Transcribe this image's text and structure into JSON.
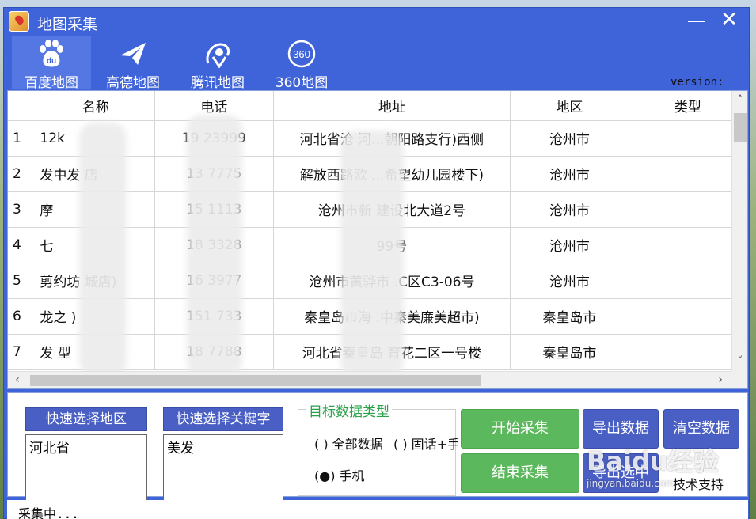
{
  "window": {
    "title": "地图采集"
  },
  "tabs": [
    {
      "label": "百度地图",
      "icon": "baidu-paw-icon"
    },
    {
      "label": "高德地图",
      "icon": "paper-plane-icon"
    },
    {
      "label": "腾讯地图",
      "icon": "tencent-pin-icon"
    },
    {
      "label": "360地图",
      "icon": "360-circle-icon"
    }
  ],
  "tab_icon_text": {
    "baidu": "du",
    "s360": "360"
  },
  "version_label": "version:",
  "grid": {
    "columns": [
      "名称",
      "电话",
      "地址",
      "地区",
      "类型"
    ],
    "rows": [
      {
        "num": "1",
        "name": "12k",
        "phone": "19     23999",
        "address": "河北省沧      河...朝阳路支行)西侧",
        "region": "沧州市",
        "type": ""
      },
      {
        "num": "2",
        "name": "发中发      店",
        "phone": "13     7775",
        "address": "解放西路欧      ...希望幼儿园楼下)",
        "region": "沧州市",
        "type": ""
      },
      {
        "num": "3",
        "name": "摩",
        "phone": "15     1113",
        "address": "沧州市新      建设北大道2号",
        "region": "沧州市",
        "type": ""
      },
      {
        "num": "4",
        "name": "七",
        "phone": "18     3328",
        "address": "99号",
        "region": "沧州市",
        "type": ""
      },
      {
        "num": "5",
        "name": "剪约坊      城店)",
        "phone": "16     3977",
        "address": "沧州市黄骅市      .C区C3-06号",
        "region": "沧州市",
        "type": ""
      },
      {
        "num": "6",
        "name": "龙之      )",
        "phone": "151     733",
        "address": "秦皇岛市海      .中秦美廉美超市)",
        "region": "秦皇岛市",
        "type": ""
      },
      {
        "num": "7",
        "name": "发      型",
        "phone": "18     7788",
        "address": "河北省秦皇岛      育花二区一号楼",
        "region": "秦皇岛市",
        "type": ""
      }
    ]
  },
  "controls": {
    "region_button": "快速选择地区",
    "region_list": [
      "河北省"
    ],
    "keyword_button": "快速选择关键字",
    "keyword_list": [
      "美发"
    ],
    "data_type_title": "目标数据类型",
    "radio_all": "( ) 全部数据",
    "radio_landline": "( ) 固话+手",
    "radio_mobile": "手机",
    "start_button": "开始采集",
    "export_button": "导出数据",
    "clear_button": "清空数据",
    "stop_button": "结束采集",
    "hidden_button": "导出选中",
    "contact_label": "技术支持"
  },
  "watermark": {
    "text": "Baidu经验",
    "sub": "jingyan.baidu.com"
  },
  "status": {
    "text": "采集中..."
  },
  "colors": {
    "window": "#3f63d8",
    "green": "#5cb85c",
    "purple": "#4a5fc4"
  }
}
